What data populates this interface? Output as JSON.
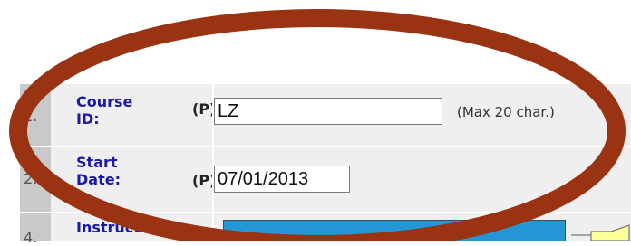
{
  "rows": [
    {
      "number": "1.",
      "label_line1": "Course",
      "label_line2": "ID:",
      "tag": "(P)",
      "value": "LZ",
      "hint": "(Max 20 char.)"
    },
    {
      "number": "2.",
      "label_line1": "Start",
      "label_line2": "Date:",
      "tag": "(P)",
      "value": "07/01/2013"
    },
    {
      "number": "4.",
      "label_line1": "Instruction"
    }
  ],
  "colors": {
    "label_blue": "#1a1aa6",
    "row_bg": "#efefef",
    "number_bg": "#c9c9c9",
    "highlight_oval": "#9a3311",
    "selection_bar": "#2496d6",
    "callout_fill": "#ffff99"
  },
  "icons": {
    "annotation": "highlight-oval",
    "callout": "callout-arrow-icon"
  }
}
